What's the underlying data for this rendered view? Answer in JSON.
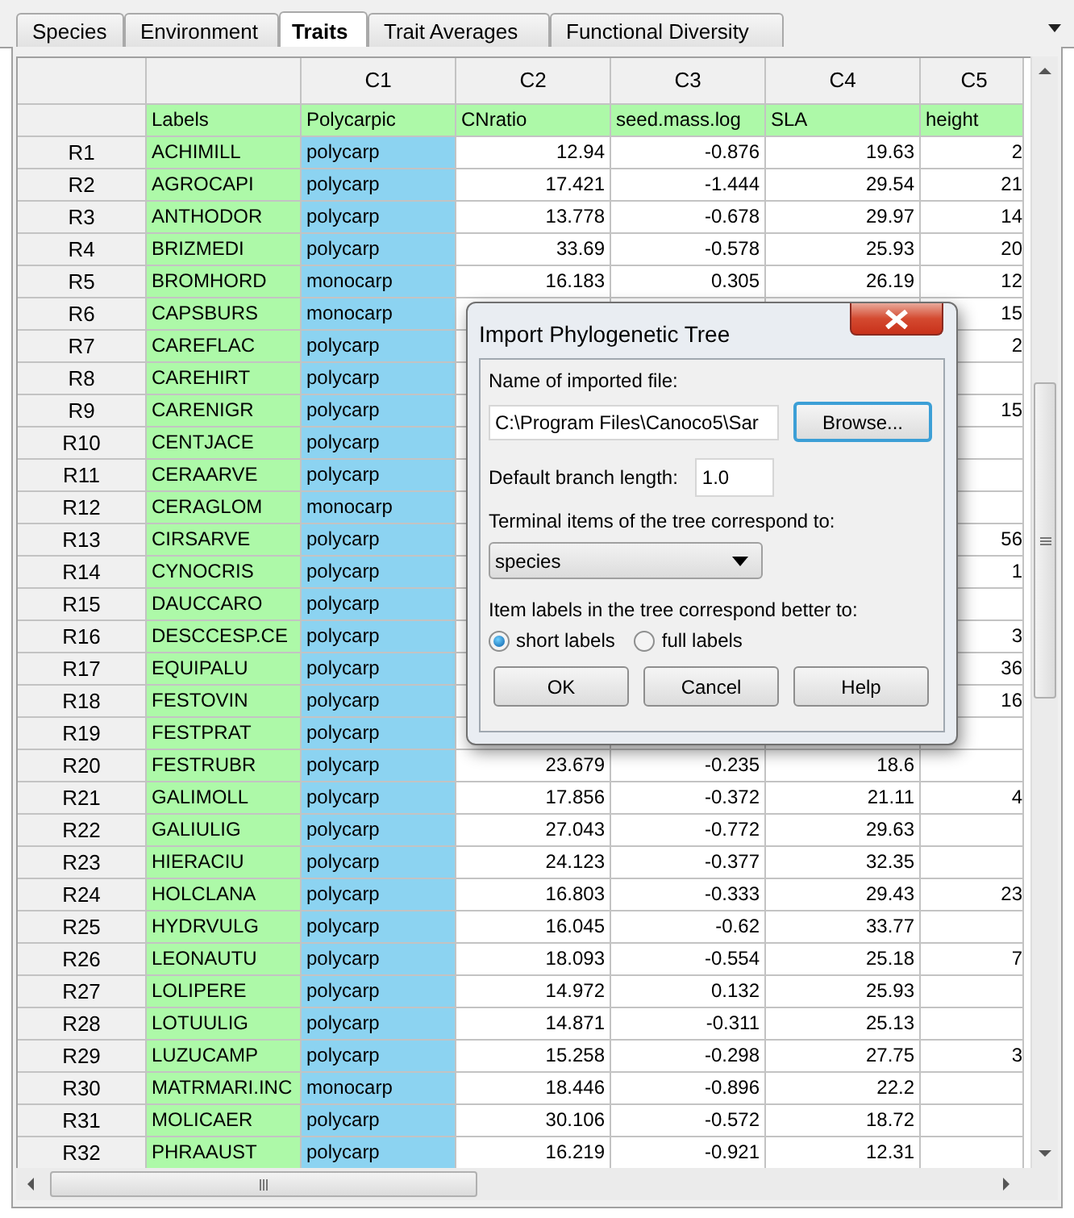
{
  "tabs": [
    {
      "label": "Species",
      "selected": false
    },
    {
      "label": "Environment",
      "selected": false
    },
    {
      "label": "Traits",
      "selected": true
    },
    {
      "label": "Trait Averages",
      "selected": false
    },
    {
      "label": "Functional Diversity",
      "selected": false
    }
  ],
  "table": {
    "columns": [
      "C1",
      "C2",
      "C3",
      "C4",
      "C5"
    ],
    "headings": [
      "Labels",
      "Polycarpic",
      "CNratio",
      "seed.mass.log",
      "SLA",
      "height"
    ],
    "rows": [
      {
        "row": "R1",
        "label": "ACHIMILL",
        "c1": "polycarp",
        "c2": "12.94",
        "c3": "-0.876",
        "c4": "19.63",
        "c5": "2"
      },
      {
        "row": "R2",
        "label": "AGROCAPI",
        "c1": "polycarp",
        "c2": "17.421",
        "c3": "-1.444",
        "c4": "29.54",
        "c5": "21"
      },
      {
        "row": "R3",
        "label": "ANTHODOR",
        "c1": "polycarp",
        "c2": "13.778",
        "c3": "-0.678",
        "c4": "29.97",
        "c5": "14"
      },
      {
        "row": "R4",
        "label": "BRIZMEDI",
        "c1": "polycarp",
        "c2": "33.69",
        "c3": "-0.578",
        "c4": "25.93",
        "c5": "20"
      },
      {
        "row": "R5",
        "label": "BROMHORD",
        "c1": "monocarp",
        "c2": "16.183",
        "c3": "0.305",
        "c4": "26.19",
        "c5": "12"
      },
      {
        "row": "R6",
        "label": "CAPSBURS",
        "c1": "monocarp",
        "c5": "15"
      },
      {
        "row": "R7",
        "label": "CAREFLAC",
        "c1": "polycarp",
        "c5": "2"
      },
      {
        "row": "R8",
        "label": "CAREHIRT",
        "c1": "polycarp"
      },
      {
        "row": "R9",
        "label": "CARENIGR",
        "c1": "polycarp",
        "c5": "15"
      },
      {
        "row": "R10",
        "label": "CENTJACE",
        "c1": "polycarp"
      },
      {
        "row": "R11",
        "label": "CERAARVE",
        "c1": "polycarp"
      },
      {
        "row": "R12",
        "label": "CERAGLOM",
        "c1": "monocarp"
      },
      {
        "row": "R13",
        "label": "CIRSARVE",
        "c1": "polycarp",
        "c5": "56"
      },
      {
        "row": "R14",
        "label": "CYNOCRIS",
        "c1": "polycarp",
        "c5": "1"
      },
      {
        "row": "R15",
        "label": "DAUCCARO",
        "c1": "polycarp"
      },
      {
        "row": "R16",
        "label": "DESCCESP.CE",
        "c1": "polycarp",
        "c5": "3"
      },
      {
        "row": "R17",
        "label": "EQUIPALU",
        "c1": "polycarp",
        "c5": "36"
      },
      {
        "row": "R18",
        "label": "FESTOVIN",
        "c1": "polycarp",
        "c5": "16"
      },
      {
        "row": "R19",
        "label": "FESTPRAT",
        "c1": "polycarp"
      },
      {
        "row": "R20",
        "label": "FESTRUBR",
        "c1": "polycarp",
        "c2": "23.679",
        "c3": "-0.235",
        "c4": "18.6"
      },
      {
        "row": "R21",
        "label": "GALIMOLL",
        "c1": "polycarp",
        "c2": "17.856",
        "c3": "-0.372",
        "c4": "21.11",
        "c5": "4"
      },
      {
        "row": "R22",
        "label": "GALIULIG",
        "c1": "polycarp",
        "c2": "27.043",
        "c3": "-0.772",
        "c4": "29.63"
      },
      {
        "row": "R23",
        "label": "HIERACIU",
        "c1": "polycarp",
        "c2": "24.123",
        "c3": "-0.377",
        "c4": "32.35"
      },
      {
        "row": "R24",
        "label": "HOLCLANA",
        "c1": "polycarp",
        "c2": "16.803",
        "c3": "-0.333",
        "c4": "29.43",
        "c5": "23"
      },
      {
        "row": "R25",
        "label": "HYDRVULG",
        "c1": "polycarp",
        "c2": "16.045",
        "c3": "-0.62",
        "c4": "33.77"
      },
      {
        "row": "R26",
        "label": "LEONAUTU",
        "c1": "polycarp",
        "c2": "18.093",
        "c3": "-0.554",
        "c4": "25.18",
        "c5": "7"
      },
      {
        "row": "R27",
        "label": "LOLIPERE",
        "c1": "polycarp",
        "c2": "14.972",
        "c3": "0.132",
        "c4": "25.93"
      },
      {
        "row": "R28",
        "label": "LOTUULIG",
        "c1": "polycarp",
        "c2": "14.871",
        "c3": "-0.311",
        "c4": "25.13"
      },
      {
        "row": "R29",
        "label": "LUZUCAMP",
        "c1": "polycarp",
        "c2": "15.258",
        "c3": "-0.298",
        "c4": "27.75",
        "c5": "3"
      },
      {
        "row": "R30",
        "label": "MATRMARI.INC",
        "c1": "monocarp",
        "c2": "18.446",
        "c3": "-0.896",
        "c4": "22.2"
      },
      {
        "row": "R31",
        "label": "MOLICAER",
        "c1": "polycarp",
        "c2": "30.106",
        "c3": "-0.572",
        "c4": "18.72"
      },
      {
        "row": "R32",
        "label": "PHRAAUST",
        "c1": "polycarp",
        "c2": "16.219",
        "c3": "-0.921",
        "c4": "12.31"
      }
    ]
  },
  "dialog": {
    "title": "Import Phylogenetic Tree",
    "file_label": "Name of imported file:",
    "file_path": "C:\\Program Files\\Canoco5\\Sar",
    "browse": {
      "label": "Browse...",
      "focused": true
    },
    "branch_label": "Default branch length:",
    "branch_length": "1.0",
    "terminal_label": "Terminal items of the tree correspond to:",
    "terminal_value": "species",
    "labels_label": "Item labels in the tree correspond better to:",
    "options": [
      {
        "label": "short labels",
        "selected": true
      },
      {
        "label": "full labels",
        "selected": false
      }
    ],
    "buttons": [
      {
        "label": "OK",
        "focused": false
      },
      {
        "label": "Cancel",
        "focused": false
      },
      {
        "label": "Help",
        "focused": false
      }
    ]
  }
}
